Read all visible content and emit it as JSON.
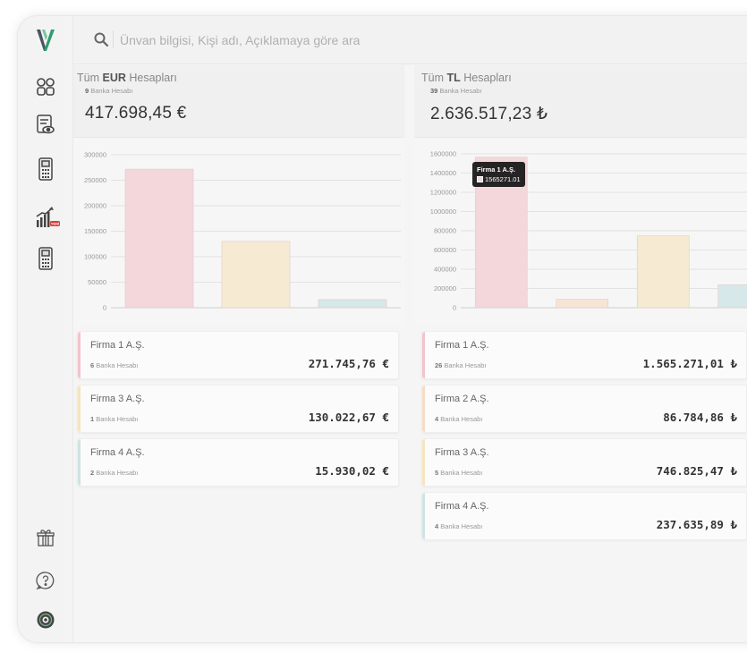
{
  "search": {
    "placeholder": "Ünvan bilgisi, Kişi adı, Açıklamaya göre ara"
  },
  "sidebar": {
    "items": [
      {
        "name": "dashboard",
        "icon": "grid-icon"
      },
      {
        "name": "reports",
        "icon": "document-eye-icon"
      },
      {
        "name": "pos",
        "icon": "pos-terminal-icon"
      },
      {
        "name": "analytics",
        "icon": "growth-chart-icon",
        "badge": "YENİ"
      },
      {
        "name": "pos-2",
        "icon": "pos-terminal-icon"
      }
    ],
    "bottom": [
      {
        "name": "gift",
        "icon": "gift-icon"
      },
      {
        "name": "help",
        "icon": "help-bubble-icon"
      },
      {
        "name": "settings",
        "icon": "settings-circle-icon"
      }
    ]
  },
  "eur": {
    "title_prefix": "Tüm ",
    "title_currency": "EUR",
    "title_suffix": " Hesapları",
    "count_number": "9",
    "count_label": " Banka Hesabı",
    "total": "417.698,45 €",
    "cards": [
      {
        "name": "Firma 1 A.Ş.",
        "count_number": "6",
        "count_label": " Banka Hesabı",
        "amount": "271.745,76 €",
        "color": "#f1c4cb"
      },
      {
        "name": "Firma 3 A.Ş.",
        "count_number": "1",
        "count_label": " Banka Hesabı",
        "amount": "130.022,67 €",
        "color": "#f5e4bf"
      },
      {
        "name": "Firma 4 A.Ş.",
        "count_number": "2",
        "count_label": " Banka Hesabı",
        "amount": "15.930,02 €",
        "color": "#cfe3e4"
      }
    ]
  },
  "tl": {
    "title_prefix": "Tüm ",
    "title_currency": "TL",
    "title_suffix": " Hesapları",
    "count_number": "39",
    "count_label": " Banka Hesabı",
    "total": "2.636.517,23 ₺",
    "cards": [
      {
        "name": "Firma 1 A.Ş.",
        "count_number": "26",
        "count_label": " Banka Hesabı",
        "amount": "1.565.271,01 ₺",
        "color": "#f1c4cb"
      },
      {
        "name": "Firma 2 A.Ş.",
        "count_number": "4",
        "count_label": " Banka Hesabı",
        "amount": "86.784,86 ₺",
        "color": "#f5dcc4"
      },
      {
        "name": "Firma 3 A.Ş.",
        "count_number": "5",
        "count_label": " Banka Hesabı",
        "amount": "746.825,47 ₺",
        "color": "#f5e4bf"
      },
      {
        "name": "Firma 4 A.Ş.",
        "count_number": "4",
        "count_label": " Banka Hesabı",
        "amount": "237.635,89 ₺",
        "color": "#cfe3e4"
      }
    ],
    "tooltip": {
      "title": "Firma 1 A.Ş.",
      "value": "1565271.01"
    }
  },
  "chart_data": [
    {
      "type": "bar",
      "categories": [
        "Firma 1 A.Ş.",
        "Firma 3 A.Ş.",
        "Firma 4 A.Ş."
      ],
      "values": [
        271745.76,
        130022.67,
        15930.02
      ],
      "colors": [
        "#f3d7db",
        "#f6ebd2",
        "#d7e8ea"
      ],
      "ylim": [
        0,
        300000
      ],
      "yticks": [
        0,
        50000,
        100000,
        150000,
        200000,
        250000,
        300000
      ],
      "ytick_labels": [
        "0",
        "50000",
        "100000",
        "150000",
        "200000",
        "250000",
        "300000"
      ],
      "grid": true,
      "title": "",
      "xlabel": "",
      "ylabel": ""
    },
    {
      "type": "bar",
      "categories": [
        "Firma 1 A.Ş.",
        "Firma 2 A.Ş.",
        "Firma 3 A.Ş.",
        "Firma 4 A.Ş."
      ],
      "values": [
        1565271.01,
        86784.86,
        746825.47,
        237635.89
      ],
      "colors": [
        "#f3d7db",
        "#f6e4d4",
        "#f6ebd2",
        "#d7e8ea"
      ],
      "ylim": [
        0,
        1600000
      ],
      "yticks": [
        0,
        200000,
        400000,
        600000,
        800000,
        1000000,
        1200000,
        1400000,
        1600000
      ],
      "ytick_labels": [
        "0",
        "200000",
        "400000",
        "600000",
        "800000",
        "1000000",
        "1200000",
        "1400000",
        "1600000"
      ],
      "grid": true,
      "title": "",
      "xlabel": "",
      "ylabel": ""
    }
  ]
}
